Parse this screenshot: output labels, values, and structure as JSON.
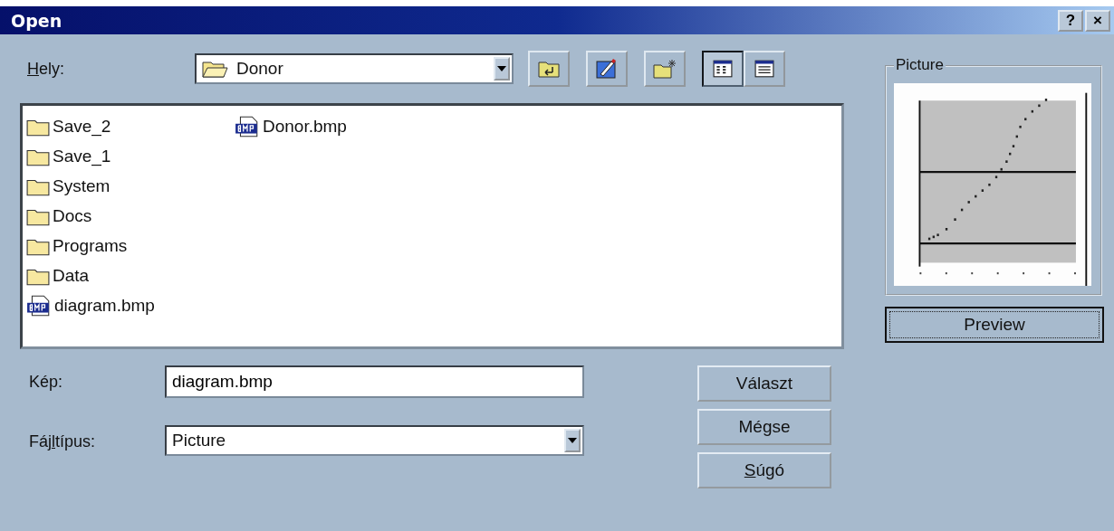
{
  "window": {
    "title": "Open",
    "title_buttons": [
      "?",
      "×"
    ]
  },
  "location": {
    "label": {
      "key": "H",
      "post": "ely:"
    },
    "value": "Donor"
  },
  "toolbar": [
    {
      "kind": "up"
    },
    {
      "kind": "graphics"
    },
    {
      "kind": "newfolder"
    }
  ],
  "view_buttons": [
    {
      "kind": "list",
      "selected": true
    },
    {
      "kind": "details",
      "selected": false
    }
  ],
  "files": [
    {
      "name": "Save_2",
      "kind": "folder"
    },
    {
      "name": "Save_1",
      "kind": "folder"
    },
    {
      "name": "System",
      "kind": "folder"
    },
    {
      "name": "Docs",
      "kind": "folder"
    },
    {
      "name": "Programs",
      "kind": "folder"
    },
    {
      "name": "Data",
      "kind": "folder"
    },
    {
      "name": "diagram.bmp",
      "kind": "bmp"
    },
    {
      "name": "Donor.bmp",
      "kind": "bmp"
    }
  ],
  "filename": {
    "label": {
      "pre": "Kép:"
    },
    "value": "diagram.bmp"
  },
  "filetype": {
    "label": {
      "pre": "Fáj",
      "key": "l",
      "post": "típus:"
    },
    "value": "Picture"
  },
  "buttons": [
    {
      "pre": "Választ"
    },
    {
      "pre": "Mégse"
    },
    {
      "key": "S",
      "post": "úgó"
    }
  ],
  "preview": {
    "title": "Picture",
    "button": "Preview"
  }
}
